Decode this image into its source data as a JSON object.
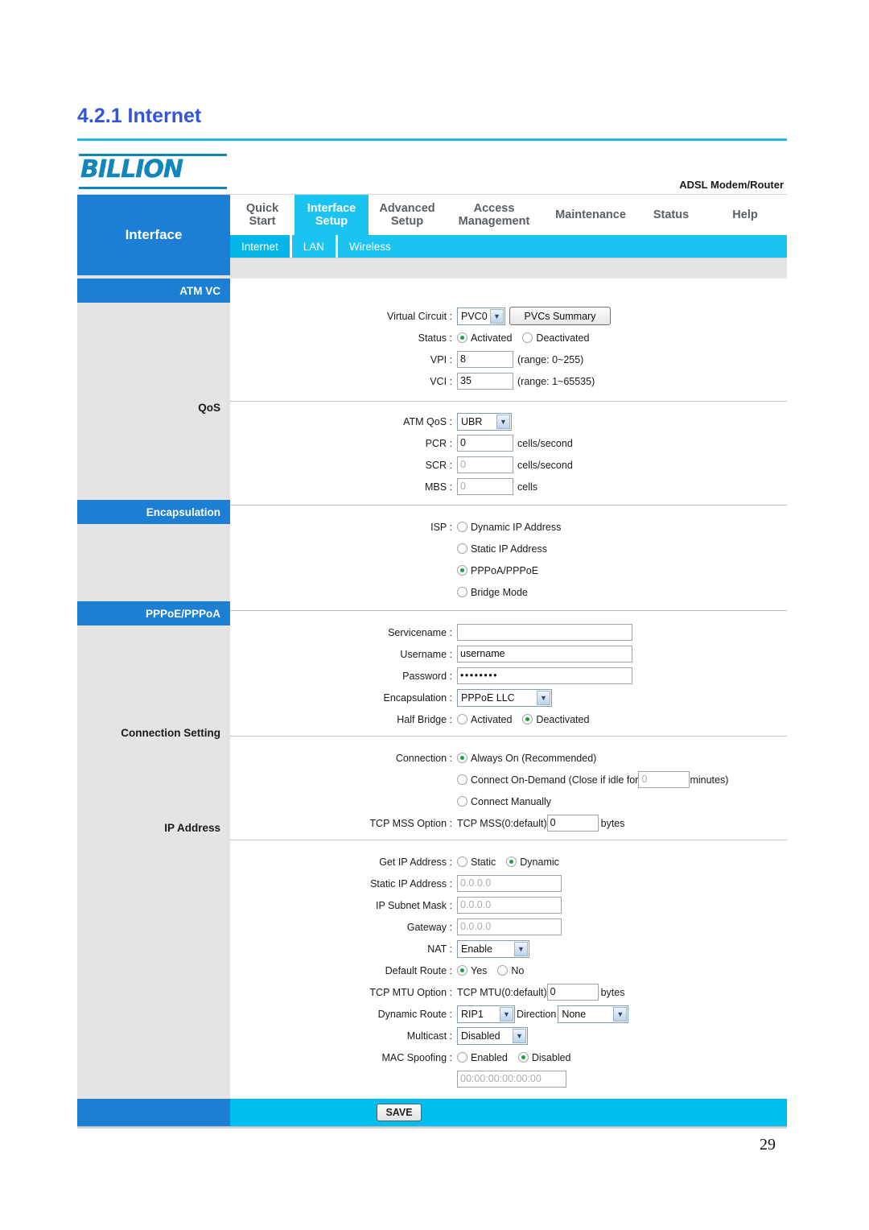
{
  "document": {
    "heading": "4.2.1 Internet",
    "page_number": "29",
    "accent_blue": "#3355dd",
    "rule_color": "#22b9e8"
  },
  "header": {
    "brand": "BILLION",
    "model": "ADSL Modem/Router",
    "section_title": "Interface",
    "brand_color": "#1186bb",
    "nav_active_color": "#1bc3f0",
    "sidebar_color": "#1c7fd4"
  },
  "nav": {
    "tabs": [
      {
        "label": "Quick\nStart",
        "active": false
      },
      {
        "label": "Interface\nSetup",
        "active": true
      },
      {
        "label": "Advanced\nSetup",
        "active": false
      },
      {
        "label": "Access\nManagement",
        "active": false
      },
      {
        "label": "Maintenance",
        "active": false
      },
      {
        "label": "Status",
        "active": false
      },
      {
        "label": "Help",
        "active": false
      }
    ],
    "subtabs": [
      {
        "label": "Internet",
        "active": true
      },
      {
        "label": "LAN",
        "active": false
      },
      {
        "label": "Wireless",
        "active": false
      }
    ]
  },
  "sidebar": {
    "items": [
      {
        "label": "ATM VC",
        "type": "header"
      },
      {
        "label": "QoS",
        "type": "label"
      },
      {
        "label": "Encapsulation",
        "type": "header"
      },
      {
        "label": "PPPoE/PPPoA",
        "type": "header"
      },
      {
        "label": "Connection Setting",
        "type": "label"
      },
      {
        "label": "IP Address",
        "type": "label"
      }
    ]
  },
  "atm_vc": {
    "virtual_circuit_label": "Virtual Circuit :",
    "virtual_circuit_value": "PVC0",
    "pvcs_summary_button": "PVCs Summary",
    "status_label": "Status :",
    "status_options": [
      {
        "label": "Activated",
        "selected": true
      },
      {
        "label": "Deactivated",
        "selected": false
      }
    ],
    "vpi_label": "VPI :",
    "vpi_value": "8",
    "vpi_range": "(range: 0~255)",
    "vci_label": "VCI :",
    "vci_value": "35",
    "vci_range": "(range: 1~65535)"
  },
  "qos": {
    "atm_qos_label": "ATM QoS :",
    "atm_qos_value": "UBR",
    "pcr_label": "PCR :",
    "pcr_value": "0",
    "pcr_unit": "cells/second",
    "scr_label": "SCR :",
    "scr_value": "0",
    "scr_unit": "cells/second",
    "mbs_label": "MBS :",
    "mbs_value": "0",
    "mbs_unit": "cells"
  },
  "encapsulation": {
    "isp_label": "ISP :",
    "isp_options": [
      {
        "label": "Dynamic IP Address",
        "selected": false
      },
      {
        "label": "Static IP Address",
        "selected": false
      },
      {
        "label": "PPPoA/PPPoE",
        "selected": true
      },
      {
        "label": "Bridge Mode",
        "selected": false
      }
    ]
  },
  "pppoe_pppoa": {
    "servicename_label": "Servicename :",
    "servicename_value": "",
    "username_label": "Username :",
    "username_value": "username",
    "password_label": "Password :",
    "password_value": "••••••••",
    "encapsulation_label": "Encapsulation :",
    "encapsulation_value": "PPPoE LLC",
    "half_bridge_label": "Half Bridge :",
    "half_bridge_options": [
      {
        "label": "Activated",
        "selected": false
      },
      {
        "label": "Deactivated",
        "selected": true
      }
    ]
  },
  "connection_setting": {
    "connection_label": "Connection :",
    "options": [
      {
        "label": "Always On (Recommended)",
        "selected": true
      },
      {
        "label": "Connect On-Demand (Close if idle for",
        "selected": false,
        "field_value": "0",
        "suffix": "minutes)"
      },
      {
        "label": "Connect Manually",
        "selected": false
      }
    ],
    "tcp_mss_label": "TCP MSS Option :",
    "tcp_mss_prefix": "TCP MSS(0:default)",
    "tcp_mss_value": "0",
    "tcp_mss_unit": "bytes"
  },
  "ip_address": {
    "get_ip_label": "Get IP Address :",
    "get_ip_options": [
      {
        "label": "Static",
        "selected": false
      },
      {
        "label": "Dynamic",
        "selected": true
      }
    ],
    "static_ip_label": "Static IP Address :",
    "static_ip_value": "0.0.0.0",
    "subnet_label": "IP Subnet Mask :",
    "subnet_value": "0.0.0.0",
    "gateway_label": "Gateway :",
    "gateway_value": "0.0.0.0",
    "nat_label": "NAT :",
    "nat_value": "Enable",
    "default_route_label": "Default Route :",
    "default_route_options": [
      {
        "label": "Yes",
        "selected": true
      },
      {
        "label": "No",
        "selected": false
      }
    ],
    "tcp_mtu_label": "TCP MTU Option :",
    "tcp_mtu_prefix": "TCP MTU(0:default)",
    "tcp_mtu_value": "0",
    "tcp_mtu_unit": "bytes",
    "dynamic_route_label": "Dynamic Route :",
    "dynamic_route_value": "RIP1",
    "direction_label": "Direction",
    "direction_value": "None",
    "multicast_label": "Multicast :",
    "multicast_value": "Disabled",
    "mac_spoofing_label": "MAC Spoofing :",
    "mac_spoofing_options": [
      {
        "label": "Enabled",
        "selected": false
      },
      {
        "label": "Disabled",
        "selected": true
      }
    ],
    "mac_value": "00:00:00:00:00:00"
  },
  "footer": {
    "save_label": "SAVE"
  }
}
